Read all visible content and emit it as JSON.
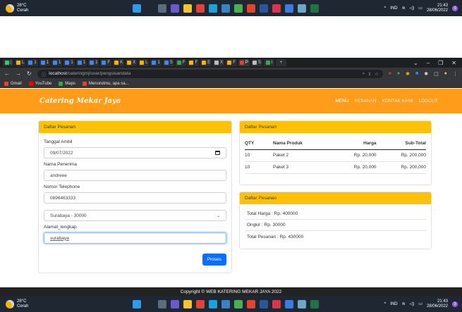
{
  "taskbar": {
    "weather_temp": "28°C",
    "weather_desc": "Cerah",
    "lang": "IND",
    "time": "21:43",
    "date": "28/06/2022",
    "badge": "3",
    "apps": [
      {
        "name": "windows-start",
        "color": "#2f9bf0"
      },
      {
        "name": "search",
        "color": "#1f2733"
      },
      {
        "name": "task-view",
        "color": "#5b6b80"
      },
      {
        "name": "chat",
        "color": "#6a5acd"
      },
      {
        "name": "file-explorer",
        "color": "#f4c430"
      },
      {
        "name": "chrome",
        "color": "#e34133"
      },
      {
        "name": "edge",
        "color": "#1aa3d9"
      },
      {
        "name": "mail",
        "color": "#3b82c4"
      },
      {
        "name": "teams-like",
        "color": "#4caf50"
      },
      {
        "name": "office",
        "color": "#e2452c"
      },
      {
        "name": "word",
        "color": "#2b579a"
      },
      {
        "name": "chat-red",
        "color": "#d9364c"
      },
      {
        "name": "notes",
        "color": "#3d7be0"
      },
      {
        "name": "settings",
        "color": "#6aa7c9"
      },
      {
        "name": "excel",
        "color": "#217346"
      }
    ]
  },
  "browser": {
    "tabs": [
      {
        "label": "(",
        "color": "#25d366"
      },
      {
        "label": "L",
        "color": "#f4b400"
      },
      {
        "label": "1",
        "color": "#4285f4"
      },
      {
        "label": "1",
        "color": "#4285f4"
      },
      {
        "label": "1",
        "color": "#4285f4"
      },
      {
        "label": "1",
        "color": "#4285f4"
      },
      {
        "label": "1",
        "color": "#4285f4"
      },
      {
        "label": "1",
        "color": "#4285f4"
      },
      {
        "label": "F",
        "color": "#4285f4"
      },
      {
        "label": "K",
        "color": "#f4b400"
      },
      {
        "label": "X",
        "color": "#f4b400"
      },
      {
        "label": "L",
        "color": "#f4b400"
      },
      {
        "label": "1",
        "color": "#4285f4"
      },
      {
        "label": "S",
        "color": "#4285f4"
      },
      {
        "label": "F",
        "color": "#34a853"
      },
      {
        "label": "F",
        "color": "#fbbc05"
      },
      {
        "label": "E",
        "color": "#f4b400"
      },
      {
        "label": "X",
        "color": "#bbbbbb"
      },
      {
        "label": "F",
        "color": "#f4b400"
      },
      {
        "label": "P",
        "color": "#e34133"
      },
      {
        "label": "S",
        "color": "#bbbbbb"
      },
      {
        "label": "I",
        "color": "#34a853"
      }
    ],
    "new_tab": "+",
    "url_host": "localhost",
    "url_path": "/cateringmj/user/pengsisandata",
    "bookmarks": [
      {
        "label": "Gmail",
        "color": "#ea4335"
      },
      {
        "label": "YouTube",
        "color": "#ff0000"
      },
      {
        "label": "Maps",
        "color": "#34a853"
      },
      {
        "label": "Menurutmu, apa sa...",
        "color": "#e34133"
      }
    ]
  },
  "site": {
    "brand": "Catering Mekar Jaya",
    "menu": [
      "MENU",
      "PESANAN",
      "KONTAK KAMI",
      "LOGOUT"
    ],
    "footer": "Copyright © WEB KATERING MEKAR JAYA 2022"
  },
  "form": {
    "title": "Daftar Pesanan",
    "date_label": "Tanggal Ambil",
    "date_value": "09/07/2022",
    "name_label": "Nama Penerima",
    "name_value": "andreee",
    "phone_label": "Nomor Telephone",
    "phone_value": "0896463333",
    "city_value": "Surabaya - 30000",
    "address_label": "Alamat_lengkap",
    "address_value": "surabaya",
    "submit": "Proses"
  },
  "orders": {
    "title": "Daftar Pesanan",
    "headers": [
      "QTY",
      "Nama Produk",
      "Harga",
      "Sub-Total"
    ],
    "rows": [
      [
        "10",
        "Paket 2",
        "Rp. 20,000",
        "Rp. 200,000"
      ],
      [
        "10",
        "Paket 3",
        "Rp. 20,000",
        "Rp. 200,000"
      ]
    ]
  },
  "totals": {
    "title": "Daftar Pesanan",
    "harga": "Total Harga : Rp. 400000",
    "ongkir": "Ongkir : Rp. 30000",
    "pesanan": "Total Pesanan : Rp. 430000"
  }
}
